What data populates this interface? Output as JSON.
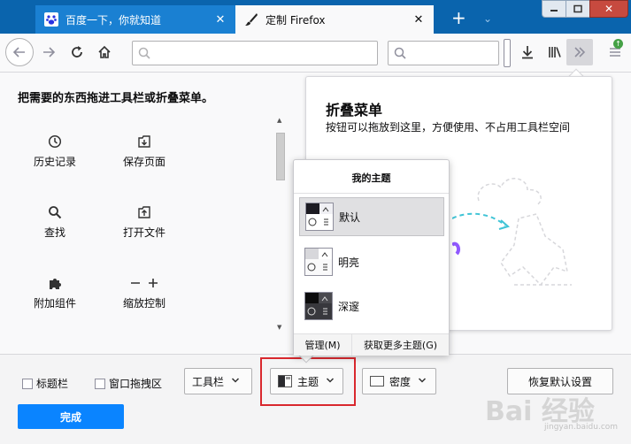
{
  "tabs": [
    {
      "title": "百度一下，你就知道",
      "close": "✕"
    },
    {
      "title": "定制 Firefox",
      "close": "✕"
    }
  ],
  "window": {
    "new_tab": "+",
    "tabs_list": "⌄",
    "min": "—",
    "max": "▢",
    "close": "✕"
  },
  "navbar": {
    "update_badge": "↑"
  },
  "palette": {
    "heading": "把需要的东西拖进工具栏或折叠菜单。",
    "items": [
      {
        "label": "历史记录",
        "icon": "clock-icon"
      },
      {
        "label": "保存页面",
        "icon": "save-page-icon"
      },
      {
        "label": "查找",
        "icon": "magnifier-icon"
      },
      {
        "label": "打开文件",
        "icon": "open-file-icon"
      },
      {
        "label": "附加组件",
        "icon": "puzzle-icon"
      },
      {
        "label": "缩放控制",
        "icon": "zoom-icon"
      }
    ]
  },
  "overflow_panel": {
    "title": "折叠菜单",
    "description": "按钮可以拖放到这里，方便使用、不占用工具栏空间"
  },
  "themes_popup": {
    "title": "我的主题",
    "themes": [
      {
        "name": "默认",
        "selected": true
      },
      {
        "name": "明亮",
        "selected": false
      },
      {
        "name": "深邃",
        "selected": false
      }
    ],
    "manage": "管理(M)",
    "get_more": "获取更多主题(G)"
  },
  "footer": {
    "titlebar_checkbox": "标题栏",
    "drag_space_checkbox": "窗口拖拽区",
    "toolbars_button": "工具栏",
    "themes_button": "主题",
    "density_button": "密度",
    "restore_button": "恢复默认设置",
    "done_button": "完成"
  },
  "watermark": {
    "main": "Bai 经验",
    "sub": "jingyan.baidu.com"
  },
  "colors": {
    "accent": "#0a84ff",
    "highlight": "#d9282e",
    "tab_active_bg": "#1a80d2",
    "tabstrip_bg": "#0a64ad"
  }
}
